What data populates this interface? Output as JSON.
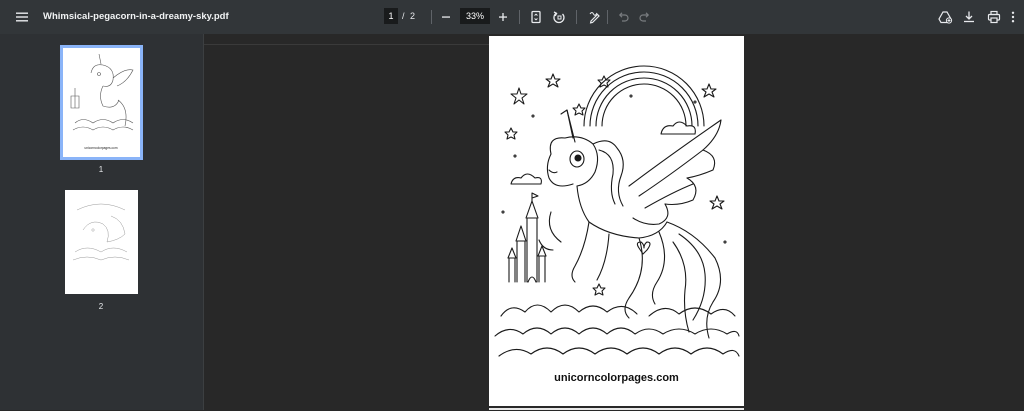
{
  "document": {
    "title": "Whimsical-pegacorn-in-a-dreamy-sky.pdf",
    "current_page": "1",
    "page_separator": "/",
    "total_pages": "2",
    "zoom": "33%"
  },
  "icons": {
    "menu": "menu-icon",
    "zoom_out": "minus-icon",
    "zoom_in": "plus-icon",
    "fit_page": "fit-page-icon",
    "rotate": "rotate-icon",
    "annotate": "pen-icon",
    "undo": "undo-icon",
    "redo": "redo-icon",
    "drive": "add-to-drive-icon",
    "download": "download-icon",
    "print": "print-icon",
    "more": "more-vert-icon"
  },
  "thumbnails": [
    {
      "number": "1",
      "selected": true
    },
    {
      "number": "2",
      "selected": false
    }
  ],
  "page_content": {
    "caption": "unicorncolorpages.com"
  },
  "colors": {
    "toolbar_bg": "#323639",
    "sidebar_bg": "#2e3134",
    "viewer_bg": "#282828",
    "selection": "#8ab4f8"
  }
}
